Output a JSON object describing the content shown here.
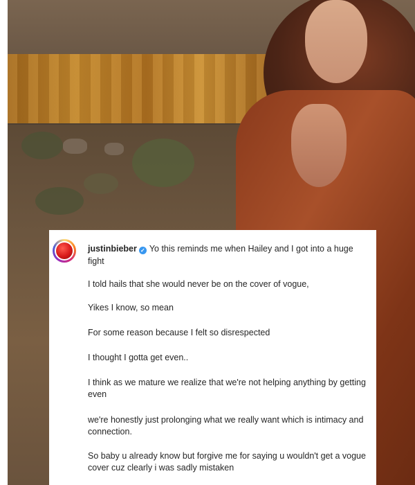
{
  "post": {
    "username": "justinbieber",
    "first_line": "Yo this reminds me when Hailey and I got into a huge fight",
    "paragraphs": [
      "I told hails that she would never be on the cover of vogue,",
      "Yikes I know, so mean",
      "For some reason because I felt so disrespected",
      "I thought I gotta get even..",
      "I think as we mature we realize that we're not helping anything by getting even",
      "we're honestly just prolonging what we really want which is intimacy and connection.",
      "So baby u already know but forgive me for saying u wouldn't get a vogue cover cuz clearly i was sadly mistaken"
    ],
    "verified_icon": "verified-badge-icon",
    "avatar_icon": "profile-avatar",
    "colors": {
      "verified": "#3897f0",
      "text": "#262626",
      "coat": "#a8502a"
    }
  }
}
